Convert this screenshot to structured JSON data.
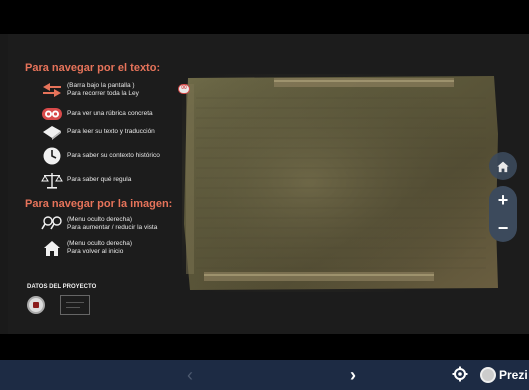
{
  "nav_heading": "Para navegar por el texto:",
  "image_heading": "Para navegar por la imagen:",
  "text_legend": [
    {
      "icon": "double-arrow-icon",
      "lines": [
        "(Barra bajo la pantalla )",
        "Para recorrer toda la Ley"
      ]
    },
    {
      "icon": "rubric-badge-icon",
      "lines": [
        "Para ver una rúbrica concreta"
      ]
    },
    {
      "icon": "book-icon",
      "lines": [
        "Para leer su texto y traducción"
      ]
    },
    {
      "icon": "clock-icon",
      "lines": [
        "Para saber su contexto histórico"
      ]
    },
    {
      "icon": "scales-icon",
      "lines": [
        "Para saber qué regula"
      ]
    }
  ],
  "image_legend": [
    {
      "icon": "magnifier-icon",
      "lines": [
        "(Menu oculto derecha)",
        "Para aumentar / reducir la vista"
      ]
    },
    {
      "icon": "home-icon",
      "lines": [
        "(Menu oculto derecha)",
        "Para volver al inicio"
      ]
    }
  ],
  "rubric_badge": "00",
  "project_label": "DATOS DEL PROYECTO",
  "zoom_in": "+",
  "zoom_out": "−",
  "nav": {
    "prev": "‹",
    "next": "›",
    "brand": "Prezi"
  },
  "colors": {
    "accent": "#e6735a",
    "navbar": "#1d2b44",
    "badge_red": "#d84a4a"
  }
}
